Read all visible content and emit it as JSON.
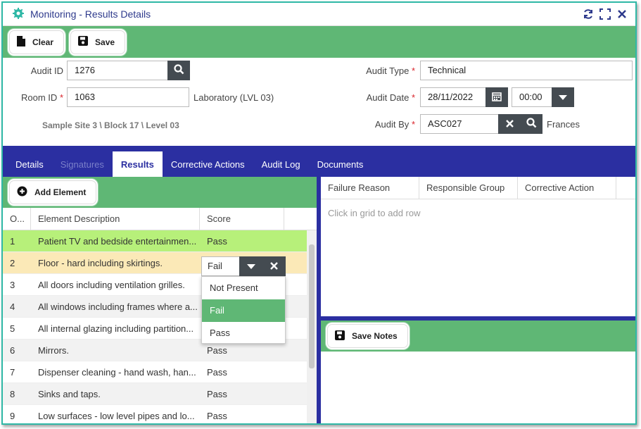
{
  "window": {
    "title": "Monitoring - Results Details"
  },
  "toolbar": {
    "clear_label": "Clear",
    "save_label": "Save"
  },
  "form": {
    "audit_id_label": "Audit ID",
    "audit_id": "1276",
    "room_id_label": "Room ID",
    "room_id": "1063",
    "room_name": "Laboratory (LVL 03)",
    "location": "Sample Site 3 \\ Block 17 \\ Level 03",
    "audit_type_label": "Audit Type",
    "audit_type": "Technical",
    "audit_date_label": "Audit Date",
    "audit_date": "28/11/2022",
    "audit_time": "00:00",
    "audit_by_label": "Audit By",
    "audit_by": "ASC027",
    "audit_by_name": "Frances",
    "required_mark": "*"
  },
  "tabs": [
    {
      "label": "Details",
      "state": "normal"
    },
    {
      "label": "Signatures",
      "state": "disabled"
    },
    {
      "label": "Results",
      "state": "active"
    },
    {
      "label": "Corrective Actions",
      "state": "normal"
    },
    {
      "label": "Audit Log",
      "state": "normal"
    },
    {
      "label": "Documents",
      "state": "normal"
    }
  ],
  "results": {
    "add_element_label": "Add Element",
    "columns": [
      "O...",
      "Element Description",
      "Score"
    ],
    "rows": [
      {
        "order": "1",
        "description": "Patient TV and bedside entertainmen...",
        "score": "Pass"
      },
      {
        "order": "2",
        "description": "Floor - hard including skirtings.",
        "score": ""
      },
      {
        "order": "3",
        "description": "All doors including ventilation grilles.",
        "score": ""
      },
      {
        "order": "4",
        "description": "All windows including frames where a...",
        "score": ""
      },
      {
        "order": "5",
        "description": "All internal glazing including partition...",
        "score": ""
      },
      {
        "order": "6",
        "description": "Mirrors.",
        "score": "Pass"
      },
      {
        "order": "7",
        "description": "Dispenser cleaning - hand wash, han...",
        "score": "Pass"
      },
      {
        "order": "8",
        "description": "Sinks and taps.",
        "score": "Pass"
      },
      {
        "order": "9",
        "description": "Low surfaces - low level pipes and lo...",
        "score": "Pass"
      }
    ],
    "editor_value": "Fail",
    "dropdown_options": [
      "Not Present",
      "Fail",
      "Pass"
    ]
  },
  "failures": {
    "columns": [
      "Failure Reason",
      "Responsible Group",
      "Corrective Action"
    ],
    "hint": "Click in grid to add row",
    "save_notes_label": "Save Notes"
  },
  "colors": {
    "green": "#5fb775",
    "navy": "#2b2fa1",
    "row_pass": "#b7f07a",
    "row_edit": "#fbe9b7",
    "dark_btn": "#444b51"
  }
}
